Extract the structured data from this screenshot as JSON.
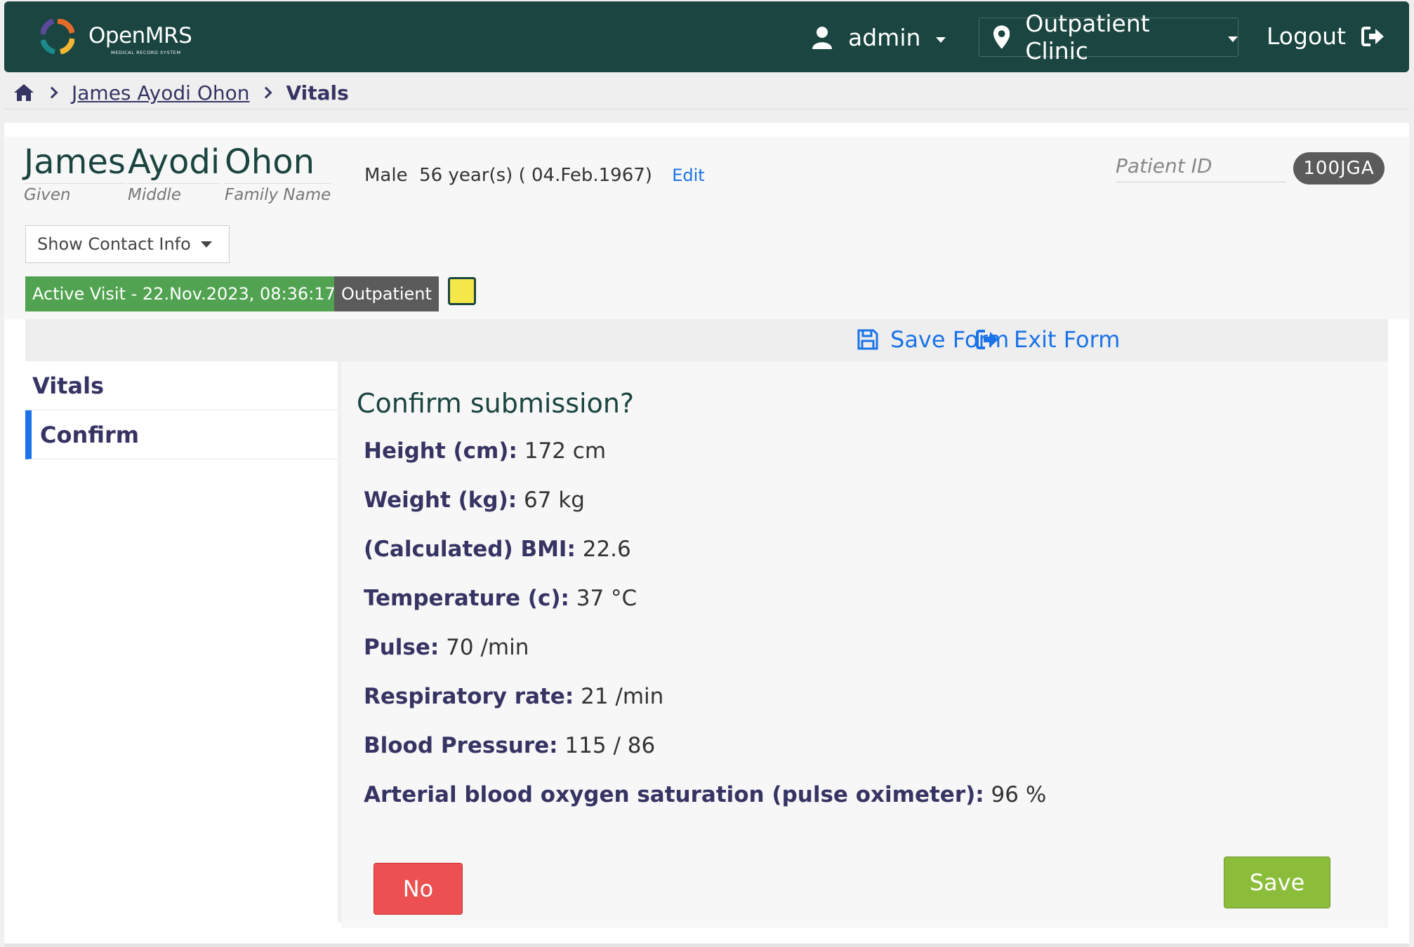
{
  "header": {
    "logo_text": "OpenMRS",
    "logo_subtext": "MEDICAL RECORD SYSTEM",
    "user": "admin",
    "location": "Outpatient Clinic",
    "logout": "Logout"
  },
  "breadcrumb": {
    "patient": "James Ayodi Ohon",
    "current": "Vitals"
  },
  "patient": {
    "given": "James",
    "middle": "Ayodi",
    "family": "Ohon",
    "given_label": "Given",
    "middle_label": "Middle",
    "family_label": "Family Name",
    "gender": "Male",
    "age": "56 year(s) ( 04.Feb.1967)",
    "edit": "Edit",
    "id_label": "Patient ID",
    "id": "100JGA",
    "contact_btn": "Show Contact Info",
    "visit": "Active Visit - 22.Nov.2023, 08:36:17",
    "visit_type": "Outpatient"
  },
  "form_actions": {
    "save": "Save Form",
    "exit": "Exit Form"
  },
  "steps": [
    "Vitals",
    "Confirm"
  ],
  "confirm": {
    "title": "Confirm submission?",
    "fields": [
      {
        "label": "Height (cm):",
        "value": "172 cm"
      },
      {
        "label": "Weight (kg):",
        "value": "67 kg"
      },
      {
        "label": "(Calculated) BMI:",
        "value": "22.6"
      },
      {
        "label": "Temperature (c):",
        "value": "37 °C"
      },
      {
        "label": "Pulse:",
        "value": "70 /min"
      },
      {
        "label": "Respiratory rate:",
        "value": "21 /min"
      },
      {
        "label": "Blood Pressure:",
        "value": "115 / 86"
      },
      {
        "label": "Arterial blood oxygen saturation (pulse oximeter):",
        "value": "96 %"
      }
    ],
    "no": "No",
    "save": "Save"
  },
  "colors": {
    "header_bg": "#1a4540",
    "link": "#1a73e8",
    "visit_badge": "#51a351",
    "no_button": "#ec5050",
    "save_button": "#8cbd3a"
  }
}
